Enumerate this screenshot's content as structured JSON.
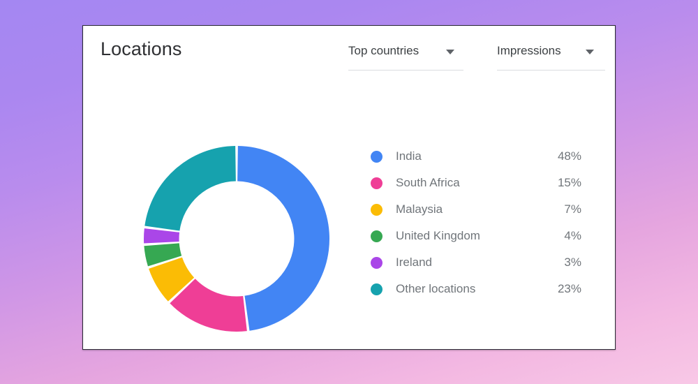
{
  "card": {
    "title": "Locations",
    "selectors": [
      {
        "label": "Top countries",
        "icon": "chevron-down-icon"
      },
      {
        "label": "Impressions",
        "icon": "chevron-down-icon"
      }
    ]
  },
  "colors": {
    "india": "#4285f4",
    "south_africa": "#ef3e96",
    "malaysia": "#fbbc05",
    "united_kingdom": "#36a852",
    "ireland": "#aa46e8",
    "other_locations": "#16a2ae",
    "card_background": "#ffffff",
    "card_border": "#2b2b35",
    "legend_text": "#70757a",
    "title_text": "#2f3033",
    "selector_text": "#3c4043",
    "selector_underline": "#dadce0",
    "background_top": "#a487f2",
    "background_bottom": "#f8c8e6"
  },
  "chart_data": {
    "type": "pie",
    "title": "Locations",
    "subtitle": "",
    "variant": "donut",
    "start_angle": 0,
    "direction": "clockwise",
    "inner_radius_ratio": 0.62,
    "units": "percent",
    "metric": "Impressions",
    "scope": "Top countries",
    "legend_position": "right",
    "grid": false,
    "categories": [
      "India",
      "South Africa",
      "Malaysia",
      "United Kingdom",
      "Ireland",
      "Other locations"
    ],
    "values": [
      48,
      15,
      7,
      4,
      3,
      23
    ],
    "labels": [
      "48%",
      "15%",
      "7%",
      "4%",
      "3%",
      "23%"
    ],
    "colors": [
      "#4285f4",
      "#ef3e96",
      "#fbbc05",
      "#36a852",
      "#aa46e8",
      "#16a2ae"
    ],
    "slices": [
      {
        "name": "India",
        "value": 48,
        "label": "48%",
        "color": "#4285f4"
      },
      {
        "name": "South Africa",
        "value": 15,
        "label": "15%",
        "color": "#ef3e96"
      },
      {
        "name": "Malaysia",
        "value": 7,
        "label": "7%",
        "color": "#fbbc05"
      },
      {
        "name": "United Kingdom",
        "value": 4,
        "label": "4%",
        "color": "#36a852"
      },
      {
        "name": "Ireland",
        "value": 3,
        "label": "3%",
        "color": "#aa46e8"
      },
      {
        "name": "Other locations",
        "value": 23,
        "label": "23%",
        "color": "#16a2ae"
      }
    ]
  }
}
